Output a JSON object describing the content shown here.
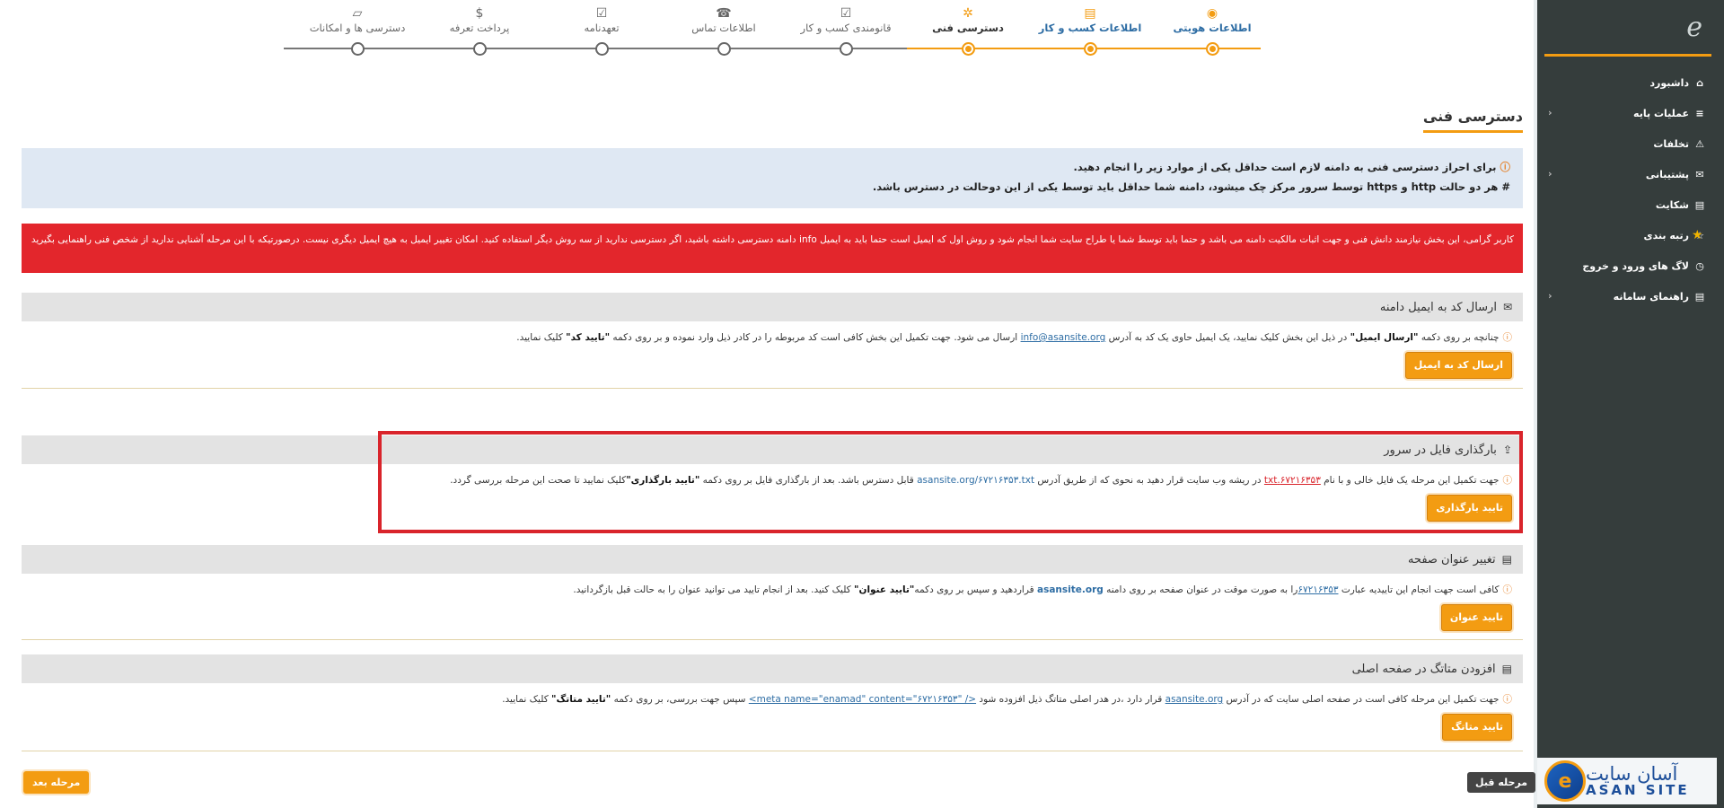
{
  "sidebar": {
    "logo_glyph": "e",
    "items": [
      {
        "label": "داشبورد",
        "icon": "home-icon",
        "glyph": "⌂",
        "chevron": false
      },
      {
        "label": "عملیات پایه",
        "icon": "list-icon",
        "glyph": "≡",
        "chevron": true
      },
      {
        "label": "تخلفات",
        "icon": "warning-icon",
        "glyph": "⚠",
        "chevron": false
      },
      {
        "label": "پشتیبانی",
        "icon": "chat-icon",
        "glyph": "✉",
        "chevron": true
      },
      {
        "label": "شکایت",
        "icon": "document-icon",
        "glyph": "▤",
        "chevron": false
      },
      {
        "label": "رتبه بندی",
        "icon": "star-outline-icon",
        "glyph": "☆",
        "chevron": false
      },
      {
        "label": "لاگ های ورود و خروج",
        "icon": "clock-icon",
        "glyph": "◷",
        "chevron": false
      },
      {
        "label": "راهنمای سامانه",
        "icon": "file-icon",
        "glyph": "▤",
        "chevron": true
      }
    ],
    "chevron_glyph": "‹",
    "star_glyph": "★"
  },
  "brand": {
    "mark": "e",
    "name_fa": "آسان سایت",
    "name_en": "ASAN SITE"
  },
  "stepper": {
    "steps": [
      {
        "label": "اطلاعات هویتی",
        "icon": "user-icon",
        "glyph": "◉",
        "state": "active"
      },
      {
        "label": "اطلاعات کسب و کار",
        "icon": "file-text-icon",
        "glyph": "▤",
        "state": "active"
      },
      {
        "label": "دسترسی فنی",
        "icon": "gears-icon",
        "glyph": "✲",
        "state": "current"
      },
      {
        "label": "قانومندی کسب و کار",
        "icon": "check-square-icon",
        "glyph": "☑",
        "state": "pending"
      },
      {
        "label": "اطلاعات تماس",
        "icon": "phone-icon",
        "glyph": "☎",
        "state": "pending"
      },
      {
        "label": "تعهدنامه",
        "icon": "check-square-outline-icon",
        "glyph": "☑",
        "state": "pending"
      },
      {
        "label": "پرداخت تعرفه",
        "icon": "dollar-icon",
        "glyph": "$",
        "state": "pending"
      },
      {
        "label": "دسترسی ها و امکانات",
        "icon": "folder-open-icon",
        "glyph": "▱",
        "state": "pending"
      }
    ]
  },
  "page": {
    "title": "دسترسی فنی"
  },
  "info": {
    "line1": "برای احراز دسترسی فنی به دامنه لازم است حداقل یکی از موارد زیر را انجام دهید.",
    "line2": "# هر دو حالت http و https توسط سرور مرکز چک میشود، دامنه شما حداقل باید توسط یکی از این دوحالت در دسترس باشد."
  },
  "alert": {
    "text": "کاربر گرامی، این بخش نیازمند دانش فنی و جهت اثبات مالکیت دامنه می باشد و حتما باید توسط شما یا طراح سایت شما انجام شود و روش اول که ایمیل است حتما باید به ایمیل info دامنه دسترسی داشته باشید، اگر دسترسی ندارید از سه روش دیگر استفاده کنید. امکان تغییر ایمیل به هیچ ایمیل دیگری نیست. درصورتیکه با این مرحله آشنایی ندارید از شخص فنی راهنمایی بگیرید"
  },
  "sections": {
    "email": {
      "title": "ارسال کد به ایمیل دامنه",
      "text_a": "چنانچه بر روی دکمه ",
      "bold_a": "\"ارسال ایمیل\"",
      "text_b": " در ذیل این بخش کلیک نمایید، یک ایمیل حاوی یک کد به آدرس ",
      "link": "info@asansite.org",
      "text_c": " ارسال می شود. جهت تکمیل این بخش کافی است کد مربوطه را در کادر ذیل وارد نموده و بر روی دکمه ",
      "bold_b": "\"تایید کد\"",
      "text_d": " کلیک نمایید.",
      "button": "ارسال کد به ایمیل"
    },
    "upload": {
      "title": "بارگذاری فایل در سرور",
      "text_a": "جهت تکمیل این مرحله یک فایل خالی و با نام ",
      "link": "۶۷۲۱۶۳۵۳.txt",
      "text_b": " در ریشه وب سایت قرار دهید به نحوی که از طریق آدرس ",
      "url": "asansite.org/۶۷۲۱۶۳۵۳.txt",
      "text_c": " قابل دسترس باشد. بعد از بارگذاری فایل بر روی دکمه ",
      "bold": "\"تایید بارگذاری\"",
      "text_d": "کلیک نمایید تا صحت این مرحله بررسی گردد.",
      "button": "تایید بارگذاری"
    },
    "title_change": {
      "title": "تغییر عنوان صفحه",
      "text_a": "کافی است جهت انجام این تاییدیه عبارت ",
      "link": "۶۷۲۱۶۳۵۳",
      "text_b": "را به صورت موقت در عنوان صفحه بر روی دامنه ",
      "domain": "asansite.org",
      "text_c": " قراردهید و سپس بر روی دکمه",
      "bold": "\"تایید عنوان\"",
      "text_d": " کلیک کنید. بعد از انجام تایید می توانید عنوان را به حالت قبل بازگردانید.",
      "button": "تایید عنوان"
    },
    "meta": {
      "title": "افزودن متاتگ در صفحه اصلی",
      "text_a": "جهت تکمیل این مرحله کافی است در صفحه اصلی سایت که در آدرس ",
      "domain": "asansite.org",
      "text_b": " قرار دارد ،در هدر اصلی متاتگ ذیل افزوده شود ",
      "code": "<meta name=\"enamad\" content=\"۶۷۲۱۶۳۵۳\" />",
      "text_c": " سپس جهت بررسی، بر روی دکمه ",
      "bold": "\"تایید متاتگ\"",
      "text_d": " کلیک نمایید.",
      "button": "تایید متاتگ"
    }
  },
  "footer": {
    "prev": "مرحله قبل",
    "next": "مرحله بعد"
  },
  "colors": {
    "accent": "#f39c12",
    "sidebar": "#353d3c",
    "alert": "#e3262c",
    "info_bg": "#dfe8f3",
    "link": "#2e6da4",
    "highlight": "#d9242b"
  }
}
